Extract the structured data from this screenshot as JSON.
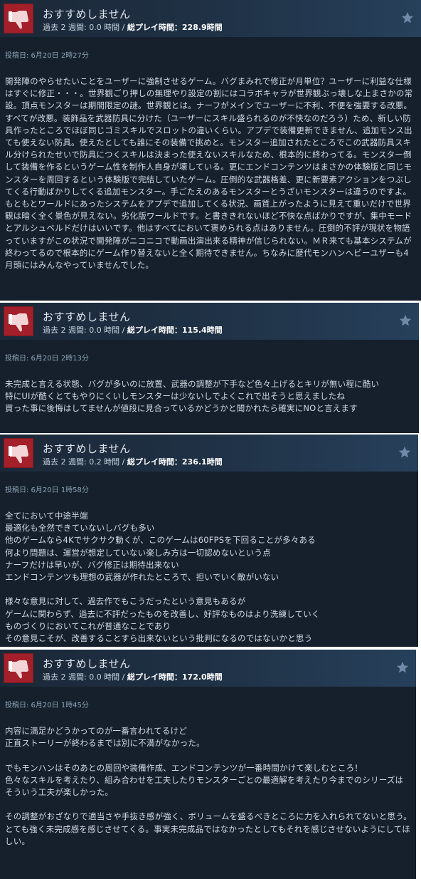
{
  "colors": {
    "thumb_bg": "#a3202a",
    "star": "#6f8aa8",
    "body_bg": "#16202d"
  },
  "reviews": [
    {
      "verdict": "おすすめしません",
      "hours_label": "過去 2 週間: 0.0 時間 /",
      "total_label": "総プレイ時間：228.9時間",
      "posted": "投稿日: 6月20日 2時27分",
      "text": "開発陣のやらせたいことをユーザーに強制させるゲーム。バグまみれで修正が月単位？ユーザーに利益な仕様はすぐに修正・・・。世界観ごり押しの無理やり設定の割にはコラボキャラが世界観ぶっ壊しな上まさかの常設。頂点モンスターは期間限定の謎。世界観とは。ナーフがメインでユーザーに不利、不便を強要する改悪。すべてが改悪。装飾品を武器防具に分けた（ユーザーにスキル盛られるのが不快なのだろう）ため、新しい防具作ったところでほぼ同じゴミスキルでスロットの違いくらい。アプデで装備更新できません、追加モンス出ても使えない防具。使えたとしても誰にその装備で挑めと。モンスター追加されたところでこの武器防具スキル分けられたせいで防具につくスキルは決まった使えないスキルなため、根本的に終わってる。モンスター倒して装備を作るというゲーム性を制作人自身が壊している。更にエンドコンテンツはまさかの体験版と同じモンスターを周回するという体験版で完結していたゲーム。圧倒的な武器格差、更に新要素アクションをつぶしてくる行動ばかりしてくる追加モンスター。手ごたえのあるモンスターとうざいモンスターは違うのですよ。もともとワールドにあったシステムをアプデで追加してくる状況、画質上がったように見えて重いだけで世界観は暗く全く景色が見えない。劣化版ワールドです。と書ききれないほど不快な点ばかりですが、集中モードとアルシュベルドだけはいいです。他はすべてにおいて褒められる点はありません。圧倒的不評が現状を物語っていますがこの状況で開発陣がニコニコで動画出演出来る精神が信じられない。ＭＲ来ても基本システムが終わってるので根本的にゲーム作り替えないと全く期待できません。ちなみに歴代モンハンヘビーユザーも4月頭にはみんなやっていませんでした。"
    },
    {
      "verdict": "おすすめしません",
      "hours_label": "過去 2 週間: 0.0 時間 /",
      "total_label": "総プレイ時間：115.4時間",
      "posted": "投稿日: 6月20日 2時13分",
      "text": "未完成と言える状態、バグが多いのに放置、武器の調整が下手など色々上げるとキリが無い程に酷い\n特にUIが酷くとてもやりにくいしモンスターは少ないしでよくこれで出そうと思えましたね\n買った事に後悔はしてませんが値段に見合っているかどうかと聞かれたら確実にNOと言えます"
    },
    {
      "verdict": "おすすめしません",
      "hours_label": "過去 2 週間: 0.2 時間 /",
      "total_label": "総プレイ時間：236.1時間",
      "posted": "投稿日: 6月20日 1時58分",
      "text": "全てにおいて中途半端\n最適化も全然できていないしバグも多い\n他のゲームなら4Kでサクサク動くが、このゲームは60FPSを下回ることが多々ある\n何より問題は、運営が想定していない楽しみ方は一切認めないという点\nナーフだけは早いが、バグ修正は期待出来ない\nエンドコンテンツも理想の武器が作れたところで、担いでいく敵がいない\n\n様々な意見に対して、過去作でもこうだったという意見もあるが\nゲームに関わらず、過去に不評だったものを改善し、好評なものはより洗練していく\nものづくりにおいてこれが普通なことであり\nその意見こそが、改善することすら出来ないという批判になるのではないかと思う"
    },
    {
      "verdict": "おすすめしません",
      "hours_label": "過去 2 週間: 0.0 時間 /",
      "total_label": "総プレイ時間：172.0時間",
      "posted": "投稿日: 6月20日 1時45分",
      "text": "内容に満足かどうかってのが一番言われてるけど\n正直ストーリーが終わるまでは別に不満がなかった。\n\nでもモンハンはそのあとの周回や装備作成、エンドコンテンツが一番時間かけて楽しむところ！\n色々なスキルを考えたり、組み合わせを工夫したりモンスターごとの最適解を考えたり今までのシリーズは\nそういう工夫が楽しかった。\n\nその調整がおざなりで適当さや手抜き感が強く、ボリュームを盛るべきところに力を入れられてないと思う。\nとても強く未完成感を感じさせてくる。事実未完成品ではなかったとしてもそれを感じさせないようにしてほしい。"
    }
  ]
}
